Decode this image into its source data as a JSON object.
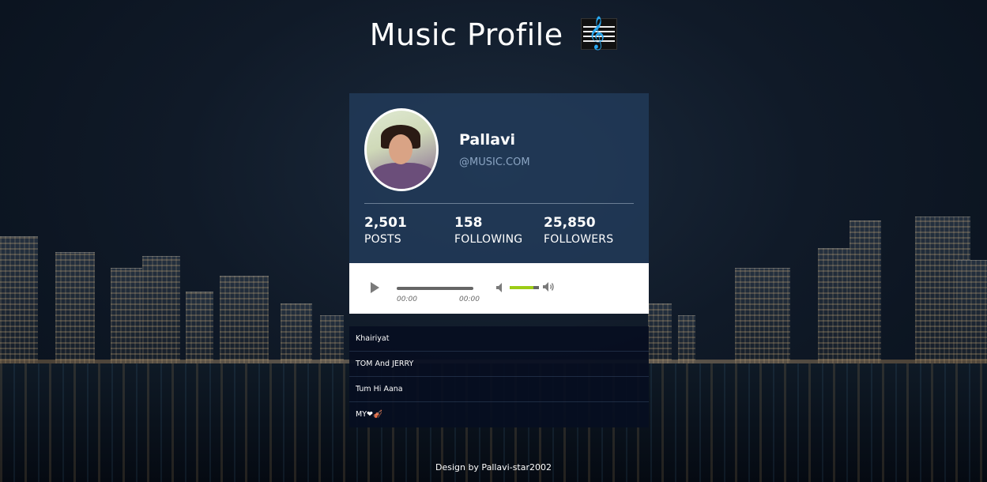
{
  "header": {
    "title": "Music Profile",
    "icon": "music-staff-clef-icon"
  },
  "profile": {
    "name": "Pallavi",
    "handle": "@MUSIC.COM",
    "avatar": "avatar-photo",
    "stats": [
      {
        "value": "2,501",
        "label": "POSTS"
      },
      {
        "value": "158",
        "label": "FOLLOWING"
      },
      {
        "value": "25,850",
        "label": "FOLLOWERS"
      }
    ]
  },
  "player": {
    "current_time": "00:00",
    "duration": "00:00",
    "progress": 0,
    "volume": 0.8,
    "accent_color": "#9ccc16"
  },
  "playlist": [
    {
      "title": "Khairiyat"
    },
    {
      "title": "TOM And JERRY"
    },
    {
      "title": "Tum Hi Aana"
    },
    {
      "title": "MY❤🎻"
    }
  ],
  "footer": {
    "credit": "Design by Pallavi-star2002"
  },
  "colors": {
    "profile_bg": "#233c5c",
    "playlist_bg": "#060e20",
    "handle_text": "#8aa4c2"
  }
}
